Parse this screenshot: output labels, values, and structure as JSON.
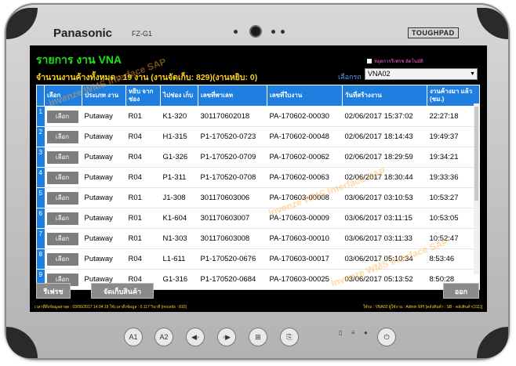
{
  "device": {
    "brand": "Panasonic",
    "model": "FZ-G1",
    "badge": "TOUGHPAD"
  },
  "app": {
    "title": "รายการ งาน VNA",
    "pending_count": "จำนวนงานค้างทั้งหมด : 19 งาน (งานจัดเก็บ: 829)(งานหยิบ: 0)",
    "checkbox_label": "หยุดการรีเฟรช อัตโนมัติ",
    "select_label": "เลือกรถ",
    "select_value": "VNA02",
    "watermark": "Invenze WMS Interface SAP"
  },
  "table": {
    "headers": [
      "",
      "เลือก",
      "ประเภท งาน",
      "หยิบ จากช่อง",
      "ไปช่อง เก็บ",
      "เลขที่พาเลท",
      "เลขที่ใบงาน",
      "วันที่สร้างงาน",
      "งานค้างมา แล้ว (ชม.)"
    ],
    "select_btn": "เลือก",
    "rows": [
      {
        "no": "1",
        "type": "Putaway",
        "from": "R01",
        "to": "K1-320",
        "pallet": "301170602018",
        "doc": "PA-170602-00030",
        "created": "02/06/2017 15:37:02",
        "age": "22:27:18"
      },
      {
        "no": "2",
        "type": "Putaway",
        "from": "R04",
        "to": "H1-315",
        "pallet": "P1-170520-0723",
        "doc": "PA-170602-00048",
        "created": "02/06/2017 18:14:43",
        "age": "19:49:37"
      },
      {
        "no": "3",
        "type": "Putaway",
        "from": "R04",
        "to": "G1-326",
        "pallet": "P1-170520-0709",
        "doc": "PA-170602-00062",
        "created": "02/06/2017 18:29:59",
        "age": "19:34:21"
      },
      {
        "no": "4",
        "type": "Putaway",
        "from": "R04",
        "to": "P1-311",
        "pallet": "P1-170520-0708",
        "doc": "PA-170602-00063",
        "created": "02/06/2017 18:30:44",
        "age": "19:33:36"
      },
      {
        "no": "5",
        "type": "Putaway",
        "from": "R01",
        "to": "J1-308",
        "pallet": "301170603006",
        "doc": "PA-170603-00008",
        "created": "03/06/2017 03:10:53",
        "age": "10:53:27"
      },
      {
        "no": "6",
        "type": "Putaway",
        "from": "R01",
        "to": "K1-604",
        "pallet": "301170603007",
        "doc": "PA-170603-00009",
        "created": "03/06/2017 03:11:15",
        "age": "10:53:05"
      },
      {
        "no": "7",
        "type": "Putaway",
        "from": "R01",
        "to": "N1-303",
        "pallet": "301170603008",
        "doc": "PA-170603-00010",
        "created": "03/06/2017 03:11:33",
        "age": "10:52:47"
      },
      {
        "no": "8",
        "type": "Putaway",
        "from": "R04",
        "to": "L1-611",
        "pallet": "P1-170520-0676",
        "doc": "PA-170603-00017",
        "created": "03/06/2017 05:10:34",
        "age": "8:53:46"
      },
      {
        "no": "9",
        "type": "Putaway",
        "from": "R04",
        "to": "G1-316",
        "pallet": "P1-170520-0684",
        "doc": "PA-170603-00025",
        "created": "03/06/2017 05:13:52",
        "age": "8:50:28"
      }
    ]
  },
  "buttons": {
    "refresh": "รีเฟรช",
    "store": "จัดเก็บสินค้า",
    "exit": "ออก"
  },
  "status": {
    "left": "เวลาที่ดึงข้อมูลล่าสุด : 03/06/2017 14:04:19 ใช้เวลาดึงข้อมูล : 0.117 วินาที [records : 810]",
    "right": "ใช้รถ : VNA02 ผู้ใช้งาน : Admin NPI [คลังสินค้า : SB - คลังสินค้า(311)]"
  },
  "hw_buttons": [
    "A1",
    "A2",
    "◀◦",
    "◦▶",
    "⊞",
    "⎘",
    "⏻"
  ]
}
